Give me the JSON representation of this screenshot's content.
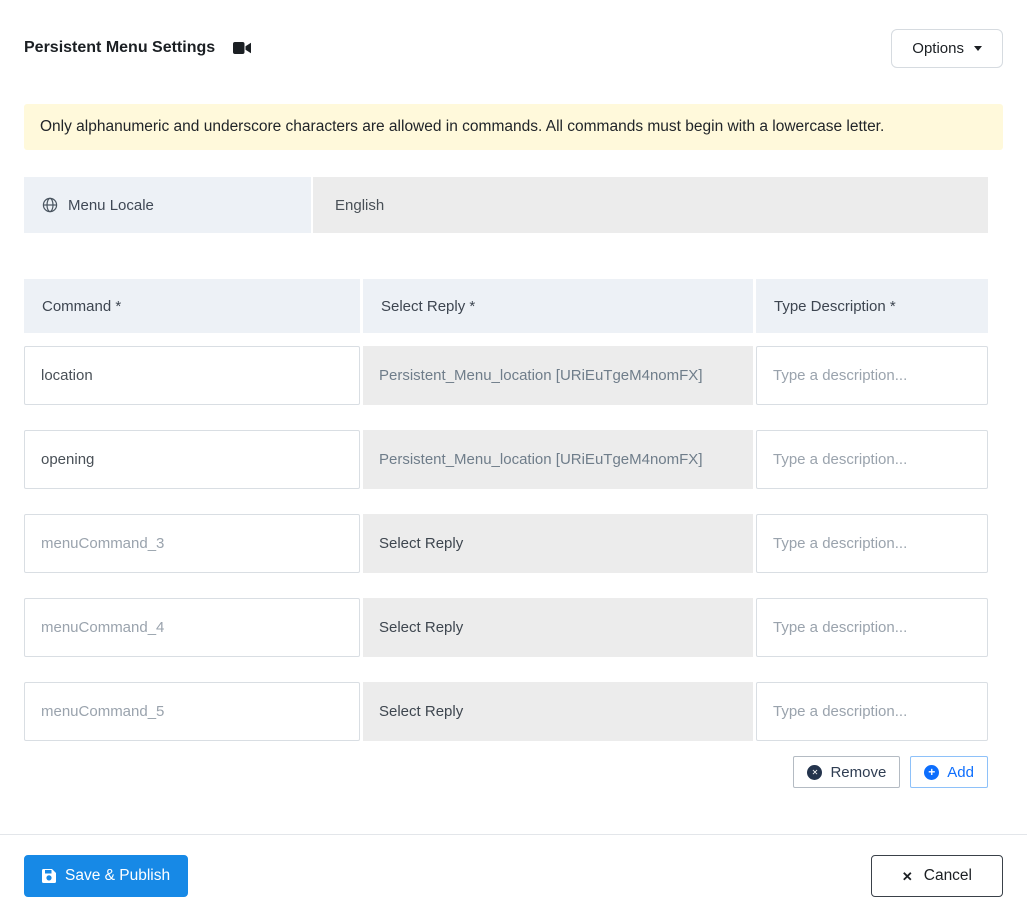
{
  "header": {
    "title": "Persistent Menu Settings",
    "options_label": "Options"
  },
  "banner": {
    "text": "Only alphanumeric and underscore characters are allowed in commands. All commands must begin with a lowercase letter."
  },
  "locale": {
    "label": "Menu Locale",
    "value": "English"
  },
  "table": {
    "headers": {
      "command": "Command *",
      "reply": "Select Reply *",
      "description": "Type Description *"
    },
    "description_placeholder": "Type a description...",
    "rows": [
      {
        "command": "location",
        "reply": "Persistent_Menu_location [URiEuTgeM4nomFX]"
      },
      {
        "command": "opening",
        "reply": "Persistent_Menu_location [URiEuTgeM4nomFX]"
      },
      {
        "command_placeholder": "menuCommand_3",
        "reply": "Select Reply"
      },
      {
        "command_placeholder": "menuCommand_4",
        "reply": "Select Reply"
      },
      {
        "command_placeholder": "menuCommand_5",
        "reply": "Select Reply"
      }
    ]
  },
  "actions": {
    "remove_label": "Remove",
    "add_label": "Add"
  },
  "footer": {
    "save_label": "Save & Publish",
    "cancel_label": "Cancel"
  },
  "colors": {
    "primary_blue": "#1789e6",
    "add_blue": "#0d6efd",
    "banner_bg": "#fff9db",
    "header_cell_bg": "#edf1f6",
    "muted_cell_bg": "#ececec"
  }
}
